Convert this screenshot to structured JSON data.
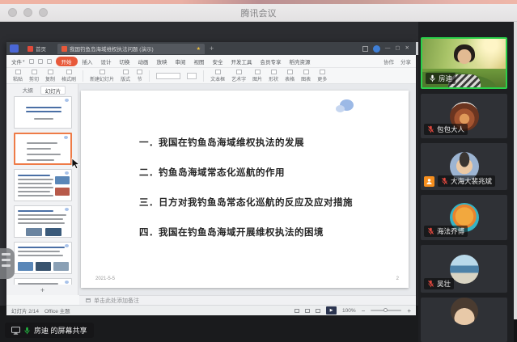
{
  "titlebar": {
    "title": "腾讯会议"
  },
  "wps": {
    "tabbar": {
      "home_tab": "首页",
      "doc_title": "我国钓鱼岛海域维权执法问题 (演示)",
      "new_tab": "+",
      "window_controls": {
        "minimize": "—",
        "maximize": "▢",
        "close": "✕"
      }
    },
    "menus": {
      "file": "文件",
      "items": [
        "开始",
        "插入",
        "设计",
        "切换",
        "动画",
        "放映",
        "审阅",
        "视图",
        "安全",
        "开发工具",
        "会员专享",
        "稻壳资源"
      ],
      "active": "开始",
      "right": [
        "协作",
        "分享"
      ]
    },
    "toolbar": {
      "items": [
        "粘贴",
        "剪切",
        "复制",
        "格式刷",
        "新建幻灯片",
        "版式",
        "节",
        "文本框",
        "艺术字",
        "图片",
        "形状",
        "表格",
        "图表",
        "更多"
      ]
    },
    "panel": {
      "tabs": [
        "大纲",
        "幻灯片"
      ],
      "active_tab": "幻灯片",
      "add_slide": "+",
      "thumbnails": [
        {
          "variant": "title",
          "selected": false
        },
        {
          "variant": "outline",
          "selected": true
        },
        {
          "variant": "text-photos",
          "selected": false
        },
        {
          "variant": "text-photos-2",
          "selected": false
        },
        {
          "variant": "text-photos-3",
          "selected": false
        },
        {
          "variant": "partial",
          "selected": false
        }
      ]
    },
    "slide": {
      "items": [
        "一．我国在钓鱼岛海域维权执法的发展",
        "二．钓鱼岛海域常态化巡航的作用",
        "三．日方对我钓鱼岛常态化巡航的反应及应对措施",
        "四．我国在钓鱼岛海域开展维权执法的困境"
      ],
      "date": "2021-5-5",
      "page_number": "2"
    },
    "notes": {
      "placeholder": "单击此处添加备注"
    },
    "statusbar": {
      "slide_indicator": "幻灯片 2/14",
      "theme": "Office 主题",
      "zoom": "100%",
      "play": "▶"
    }
  },
  "share_banner": {
    "label": "房迪 的屏幕共享"
  },
  "participants": [
    {
      "name": "房迪",
      "muted": false,
      "video": true,
      "speaking": true,
      "avatar": "video-feed"
    },
    {
      "name": "包包大人",
      "muted": true,
      "video": false,
      "speaking": false,
      "avatar": "bull-cartoon"
    },
    {
      "name": "大海大裴兆斌",
      "muted": true,
      "video": false,
      "speaking": false,
      "avatar": "person-photo",
      "host_badge": true
    },
    {
      "name": "海法乔博",
      "muted": true,
      "video": false,
      "speaking": false,
      "avatar": "cartoon-face"
    },
    {
      "name": "吴壮",
      "muted": true,
      "video": false,
      "speaking": false,
      "avatar": "sea-photo"
    },
    {
      "name": "",
      "muted": null,
      "video": false,
      "speaking": false,
      "avatar": "partial",
      "partial": true
    }
  ],
  "colors": {
    "speaking_border": "#2ad04a",
    "muted_red": "#e5493f",
    "host_badge_orange": "#f78f1e",
    "wps_accent": "#e8593a",
    "thumb_selected": "#ee7b47",
    "slide_blob": "#a9c3ea"
  }
}
